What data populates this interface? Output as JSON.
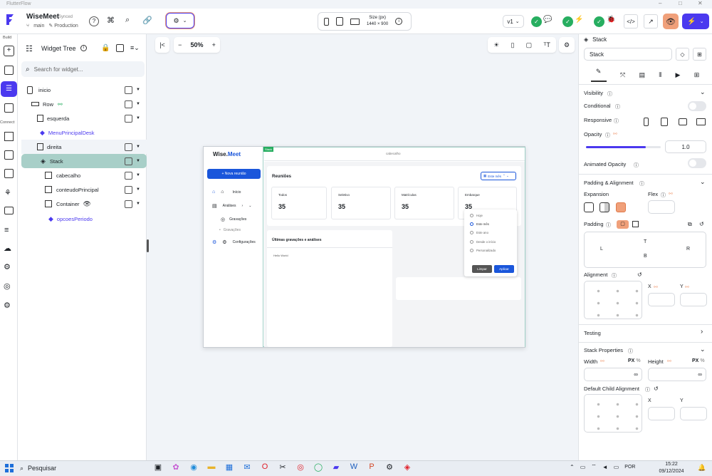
{
  "app": {
    "window_title": "FlutterFlow"
  },
  "project": {
    "name": "WiseMeet",
    "status": "Synced",
    "branch": "main",
    "env": "Production"
  },
  "rail": {
    "build": "Build",
    "connect": "Connect"
  },
  "device": {
    "size_label": "Size (px)",
    "size_value": "1440 × 900"
  },
  "version": "v1",
  "zoom": "50%",
  "tree": {
    "title": "Widget Tree",
    "search_placeholder": "Search for widget...",
    "items": [
      {
        "label": "inicio"
      },
      {
        "label": "Row"
      },
      {
        "label": "esquerda"
      },
      {
        "label": "MenuPrincipalDesk"
      },
      {
        "label": "direita"
      },
      {
        "label": "Stack"
      },
      {
        "label": "cabecalho"
      },
      {
        "label": "conteudoPrincipal"
      },
      {
        "label": "Container"
      },
      {
        "label": "opcoesPeriodo"
      }
    ]
  },
  "preview": {
    "logo_a": "Wise.",
    "logo_b": "Meet",
    "new_meeting": "+ Nova reunião",
    "nav": [
      {
        "label": "Início"
      },
      {
        "label": "Análises"
      },
      {
        "label": "Gravações"
      },
      {
        "label": "Gravações"
      },
      {
        "label": "Configurações"
      }
    ],
    "header_label": "cabecalho",
    "tag": "Stack",
    "meetings_title": "Reuniões",
    "period_select": "Este mês",
    "stats": [
      {
        "label": "Todos",
        "value": "35"
      },
      {
        "label": "Seletivo",
        "value": "35"
      },
      {
        "label": "Matrículas",
        "value": "35"
      },
      {
        "label": "Embarque",
        "value": "35"
      }
    ],
    "recordings_title": "Últimas gravações e análises",
    "hello": "Hello World",
    "options": [
      "Hoje",
      "Este mês",
      "Este ano",
      "Desde o início",
      "Personalizado"
    ],
    "clear": "Limpar",
    "apply": "Aplicar"
  },
  "props": {
    "widget_type": "Stack",
    "name_value": "Stack",
    "visibility": "Visibility",
    "conditional": "Conditional",
    "responsive": "Responsive",
    "opacity": "Opacity",
    "opacity_value": "1.0",
    "opacity_level": 0.8,
    "animated_opacity": "Animated Opacity",
    "padding_alignment": "Padding & Alignment",
    "expansion": "Expansion",
    "flex": "Flex",
    "padding": "Padding",
    "pad_t": "T",
    "pad_l": "L",
    "pad_r": "R",
    "pad_b": "B",
    "alignment": "Alignment",
    "x": "X",
    "y": "Y",
    "testing": "Testing",
    "stack_props": "Stack Properties",
    "width": "Width",
    "height": "Height",
    "px": "PX",
    "pct": "%",
    "inf": "∞",
    "default_child_alignment": "Default Child Alignment"
  },
  "taskbar": {
    "search": "Pesquisar",
    "lang": "POR",
    "time": "15:22",
    "date": "09/12/2024"
  },
  "colors": {
    "primary": "#4b39ef",
    "tree_selected": "#a8cfc8",
    "accent_orange": "#f0a07a",
    "green": "#27ae60",
    "preview_blue": "#1a56db"
  }
}
